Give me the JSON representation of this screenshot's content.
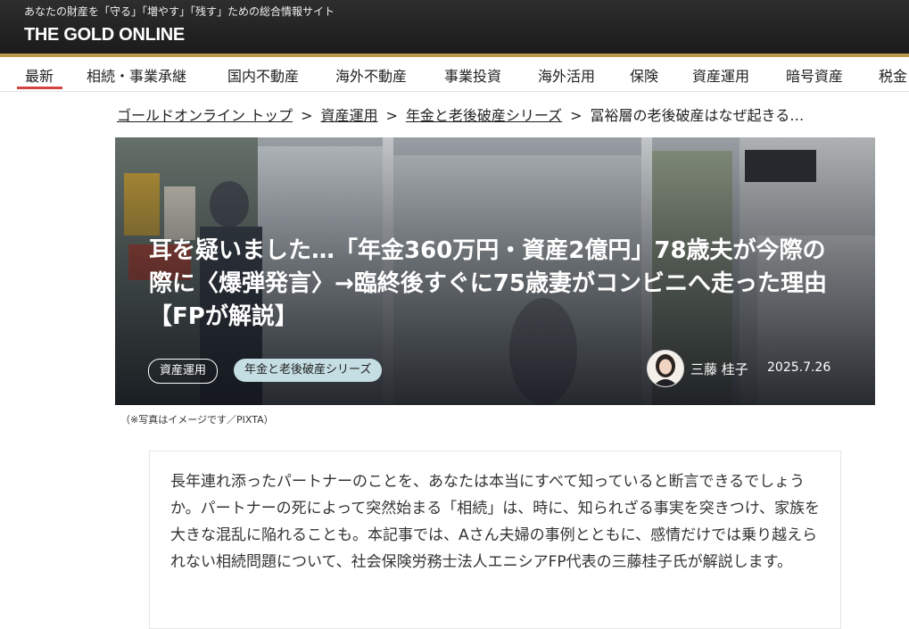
{
  "header": {
    "tagline": "あなたの財産を「守る」「増やす」「残す」ための総合情報サイト",
    "logo": "THE GOLD ONLINE"
  },
  "nav": {
    "items": [
      {
        "label": "最新",
        "active": true
      },
      {
        "label": "相続・事業承継"
      },
      {
        "label": "国内不動産"
      },
      {
        "label": "海外不動産"
      },
      {
        "label": "事業投資"
      },
      {
        "label": "海外活用"
      },
      {
        "label": "保険"
      },
      {
        "label": "資産運用"
      },
      {
        "label": "暗号資産"
      },
      {
        "label": "税金"
      }
    ],
    "active_color": "#d34545"
  },
  "breadcrumb": {
    "items": [
      "ゴールドオンライン トップ",
      "資産運用",
      "年金と老後破産シリーズ"
    ],
    "current": "冨裕層の老後破産はなぜ起きる…",
    "separator": ">"
  },
  "article": {
    "title": "耳を疑いました…「年金360万円・資産2億円」78歳夫が今際の際に〈爆弾発言〉→臨終後すぐに75歳妻がコンビニへ走った理由【FPが解説】",
    "tags": [
      "資産運用",
      "年金と老後破産シリーズ"
    ],
    "author": "三藤 桂子",
    "date": "2025.7.26",
    "photo_caption": "（※写真はイメージです／PIXTA）",
    "lead": "長年連れ添ったパートナーのことを、あなたは本当にすべて知っていると断言できるでしょうか。パートナーの死によって突然始まる「相続」は、時に、知られざる事実を突きつけ、家族を大きな混乱に陥れることも。本記事では、Aさん夫婦の事例とともに、感情だけでは乗り越えられない相続問題について、社会保険労務士法人エニシアFP代表の三藤桂子氏が解説します。"
  },
  "colors": {
    "header_bg": "#1f1f1f",
    "gold_accent": "#b99a4a",
    "tag_light_bg": "#c5dee3"
  }
}
